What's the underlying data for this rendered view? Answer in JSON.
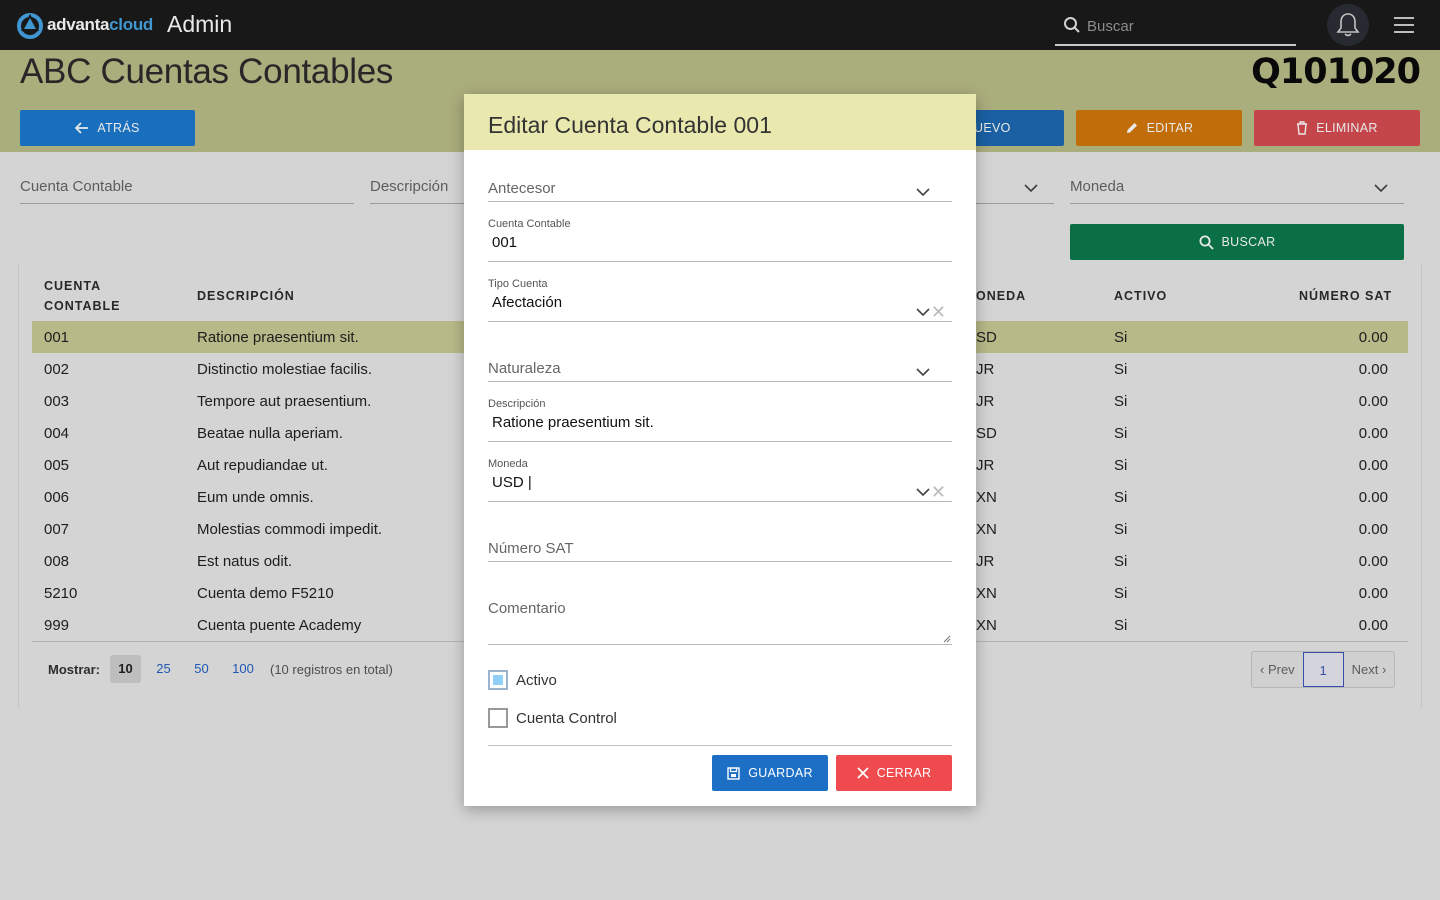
{
  "topbar": {
    "brand_part1": "advanta",
    "brand_part2": "cloud",
    "app_title": "Admin",
    "search_placeholder": "Buscar"
  },
  "header": {
    "title": "ABC Cuentas Contables",
    "record_code": "Q101020",
    "back_label": "ATRÁS",
    "new_label": "NUEVO",
    "new_visible_label": "UEVO",
    "edit_label": "EDITAR",
    "delete_label": "ELIMINAR"
  },
  "filters": {
    "cuenta_label": "Cuenta Contable",
    "descripcion_label": "Descripción",
    "moneda_label": "Moneda",
    "search_button": "BUSCAR"
  },
  "table": {
    "headers": {
      "cuenta_line1": "CUENTA",
      "cuenta_line2": "CONTABLE",
      "descripcion": "DESCRIPCIÓN",
      "moneda_visible": "ONEDA",
      "activo": "ACTIVO",
      "numero_sat": "NÚMERO SAT"
    },
    "rows": [
      {
        "cuenta": "001",
        "descripcion": "Ratione praesentium sit.",
        "moneda": "SD",
        "activo": "Si",
        "numero_sat": "0.00",
        "selected": true
      },
      {
        "cuenta": "002",
        "descripcion": "Distinctio molestiae facilis.",
        "moneda": "JR",
        "activo": "Si",
        "numero_sat": "0.00"
      },
      {
        "cuenta": "003",
        "descripcion": "Tempore aut praesentium.",
        "moneda": "JR",
        "activo": "Si",
        "numero_sat": "0.00"
      },
      {
        "cuenta": "004",
        "descripcion": "Beatae nulla aperiam.",
        "moneda": "SD",
        "activo": "Si",
        "numero_sat": "0.00"
      },
      {
        "cuenta": "005",
        "descripcion": "Aut repudiandae ut.",
        "moneda": "JR",
        "activo": "Si",
        "numero_sat": "0.00"
      },
      {
        "cuenta": "006",
        "descripcion": "Eum unde omnis.",
        "moneda": "XN",
        "activo": "Si",
        "numero_sat": "0.00"
      },
      {
        "cuenta": "007",
        "descripcion": "Molestias commodi impedit.",
        "moneda": "XN",
        "activo": "Si",
        "numero_sat": "0.00"
      },
      {
        "cuenta": "008",
        "descripcion": "Est natus odit.",
        "moneda": "JR",
        "activo": "Si",
        "numero_sat": "0.00"
      },
      {
        "cuenta": "5210",
        "descripcion": "Cuenta demo F5210",
        "moneda": "XN",
        "activo": "Si",
        "numero_sat": "0.00"
      },
      {
        "cuenta": "999",
        "descripcion": "Cuenta puente Academy",
        "moneda": "XN",
        "activo": "Si",
        "numero_sat": "0.00"
      }
    ]
  },
  "pagination": {
    "show_label": "Mostrar:",
    "sizes": [
      "10",
      "25",
      "50",
      "100"
    ],
    "active_size": "10",
    "total_text": "(10 registros en total)",
    "prev": "‹ Prev",
    "current_page": "1",
    "next": "Next ›"
  },
  "modal": {
    "title": "Editar Cuenta Contable 001",
    "antecesor_label": "Antecesor",
    "cuenta_label": "Cuenta Contable",
    "cuenta_value": "001",
    "tipo_label": "Tipo Cuenta",
    "tipo_value": "Afectación",
    "naturaleza_label": "Naturaleza",
    "descripcion_label": "Descripción",
    "descripcion_value": "Ratione praesentium sit.",
    "moneda_label": "Moneda",
    "moneda_value": "USD |",
    "numero_sat_label": "Número SAT",
    "comentario_label": "Comentario",
    "activo_label": "Activo",
    "activo_checked": true,
    "cuenta_control_label": "Cuenta Control",
    "cuenta_control_checked": false,
    "save_label": "GUARDAR",
    "close_label": "CERRAR"
  },
  "colors": {
    "topbar": "#1b1b1b",
    "header_band": "#bbbe88",
    "modal_header": "#e9e9af",
    "back_button": "#1c7ad0",
    "edit_button": "#d4780b",
    "delete_button": "#d74c51",
    "search_button": "#0d7a4c",
    "save_button": "#1c6fc4",
    "close_button": "#ef4b4f"
  }
}
